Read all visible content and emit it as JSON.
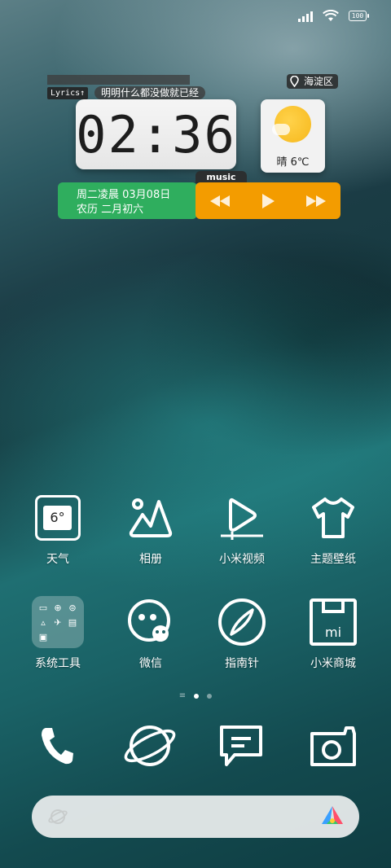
{
  "status_bar": {
    "battery_level": "100",
    "icons": [
      "signal-icon",
      "wifi-icon",
      "battery-icon"
    ]
  },
  "widgets": {
    "lyrics": {
      "tag": "Lyrics",
      "tag_icon": "arrow-up-icon",
      "text": "明明什么都没做就已经"
    },
    "location": {
      "name": "海淀区",
      "icon": "location-pin-icon"
    },
    "clock": {
      "time": "02:36"
    },
    "weather": {
      "condition": "晴",
      "temperature": "6℃",
      "icon": "sunny-icon"
    },
    "date": {
      "line1": "周二凌晨 03月08日",
      "line2": "农历 二月初六"
    },
    "music": {
      "tag": "music",
      "controls": [
        "previous-icon",
        "play-icon",
        "next-icon"
      ]
    }
  },
  "apps": [
    {
      "label": "天气",
      "icon": "weather-app-icon",
      "icon_text": "6°"
    },
    {
      "label": "相册",
      "icon": "gallery-icon"
    },
    {
      "label": "小米视频",
      "icon": "video-icon"
    },
    {
      "label": "主题壁纸",
      "icon": "shirt-icon"
    },
    {
      "label": "系统工具",
      "icon": "tools-folder-icon"
    },
    {
      "label": "微信",
      "icon": "wechat-icon"
    },
    {
      "label": "指南针",
      "icon": "compass-icon"
    },
    {
      "label": "小米商城",
      "icon": "mi-store-icon",
      "icon_text": "mi"
    }
  ],
  "page_indicator": {
    "pages": 2,
    "current": 1
  },
  "dock": [
    "phone-icon",
    "browser-icon",
    "messages-icon",
    "camera-icon"
  ],
  "search_bar": {
    "left_icon": "browser-small-icon",
    "right_icon": "app-vault-icon"
  },
  "colors": {
    "date_card": "#2fae5e",
    "music_card": "#f39c00",
    "clock_bg": "#f0f0f0",
    "sun": "#f6b81c"
  }
}
